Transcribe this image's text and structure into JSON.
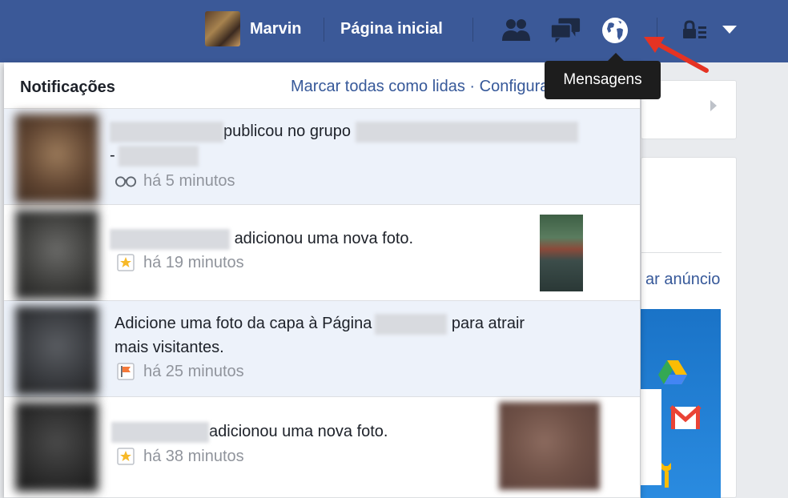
{
  "topbar": {
    "user_name": "Marvin",
    "home_label": "Página inicial",
    "icons": [
      "friends-icon",
      "messages-icon",
      "globe-icon",
      "lock-menu-icon",
      "caret-down-icon"
    ],
    "tooltip": "Mensagens"
  },
  "panel": {
    "title": "Notificações",
    "actions": "Marcar todas como lidas · Configurações"
  },
  "notifications": [
    {
      "text_a": "publicou no grupo",
      "text_b": "-",
      "time": "há 5 minutos",
      "icon": "glasses-icon",
      "unread": true
    },
    {
      "text_a": "adicionou uma nova foto.",
      "time": "há 19 minutos",
      "icon": "star-icon",
      "unread": false
    },
    {
      "text_a": "Adicione uma foto da capa à Página",
      "text_b": "para atrair",
      "text_c": "mais visitantes.",
      "time": "há 25 minutos",
      "icon": "flag-icon",
      "unread": true
    },
    {
      "text_a": "adicionou uma nova foto.",
      "time": "há 38 minutos",
      "icon": "star-icon",
      "unread": false
    }
  ],
  "right": {
    "link": "ar anúncio"
  },
  "colors": {
    "brand": "#3b5998",
    "link": "#365899",
    "unread_bg": "#edf2fa"
  }
}
